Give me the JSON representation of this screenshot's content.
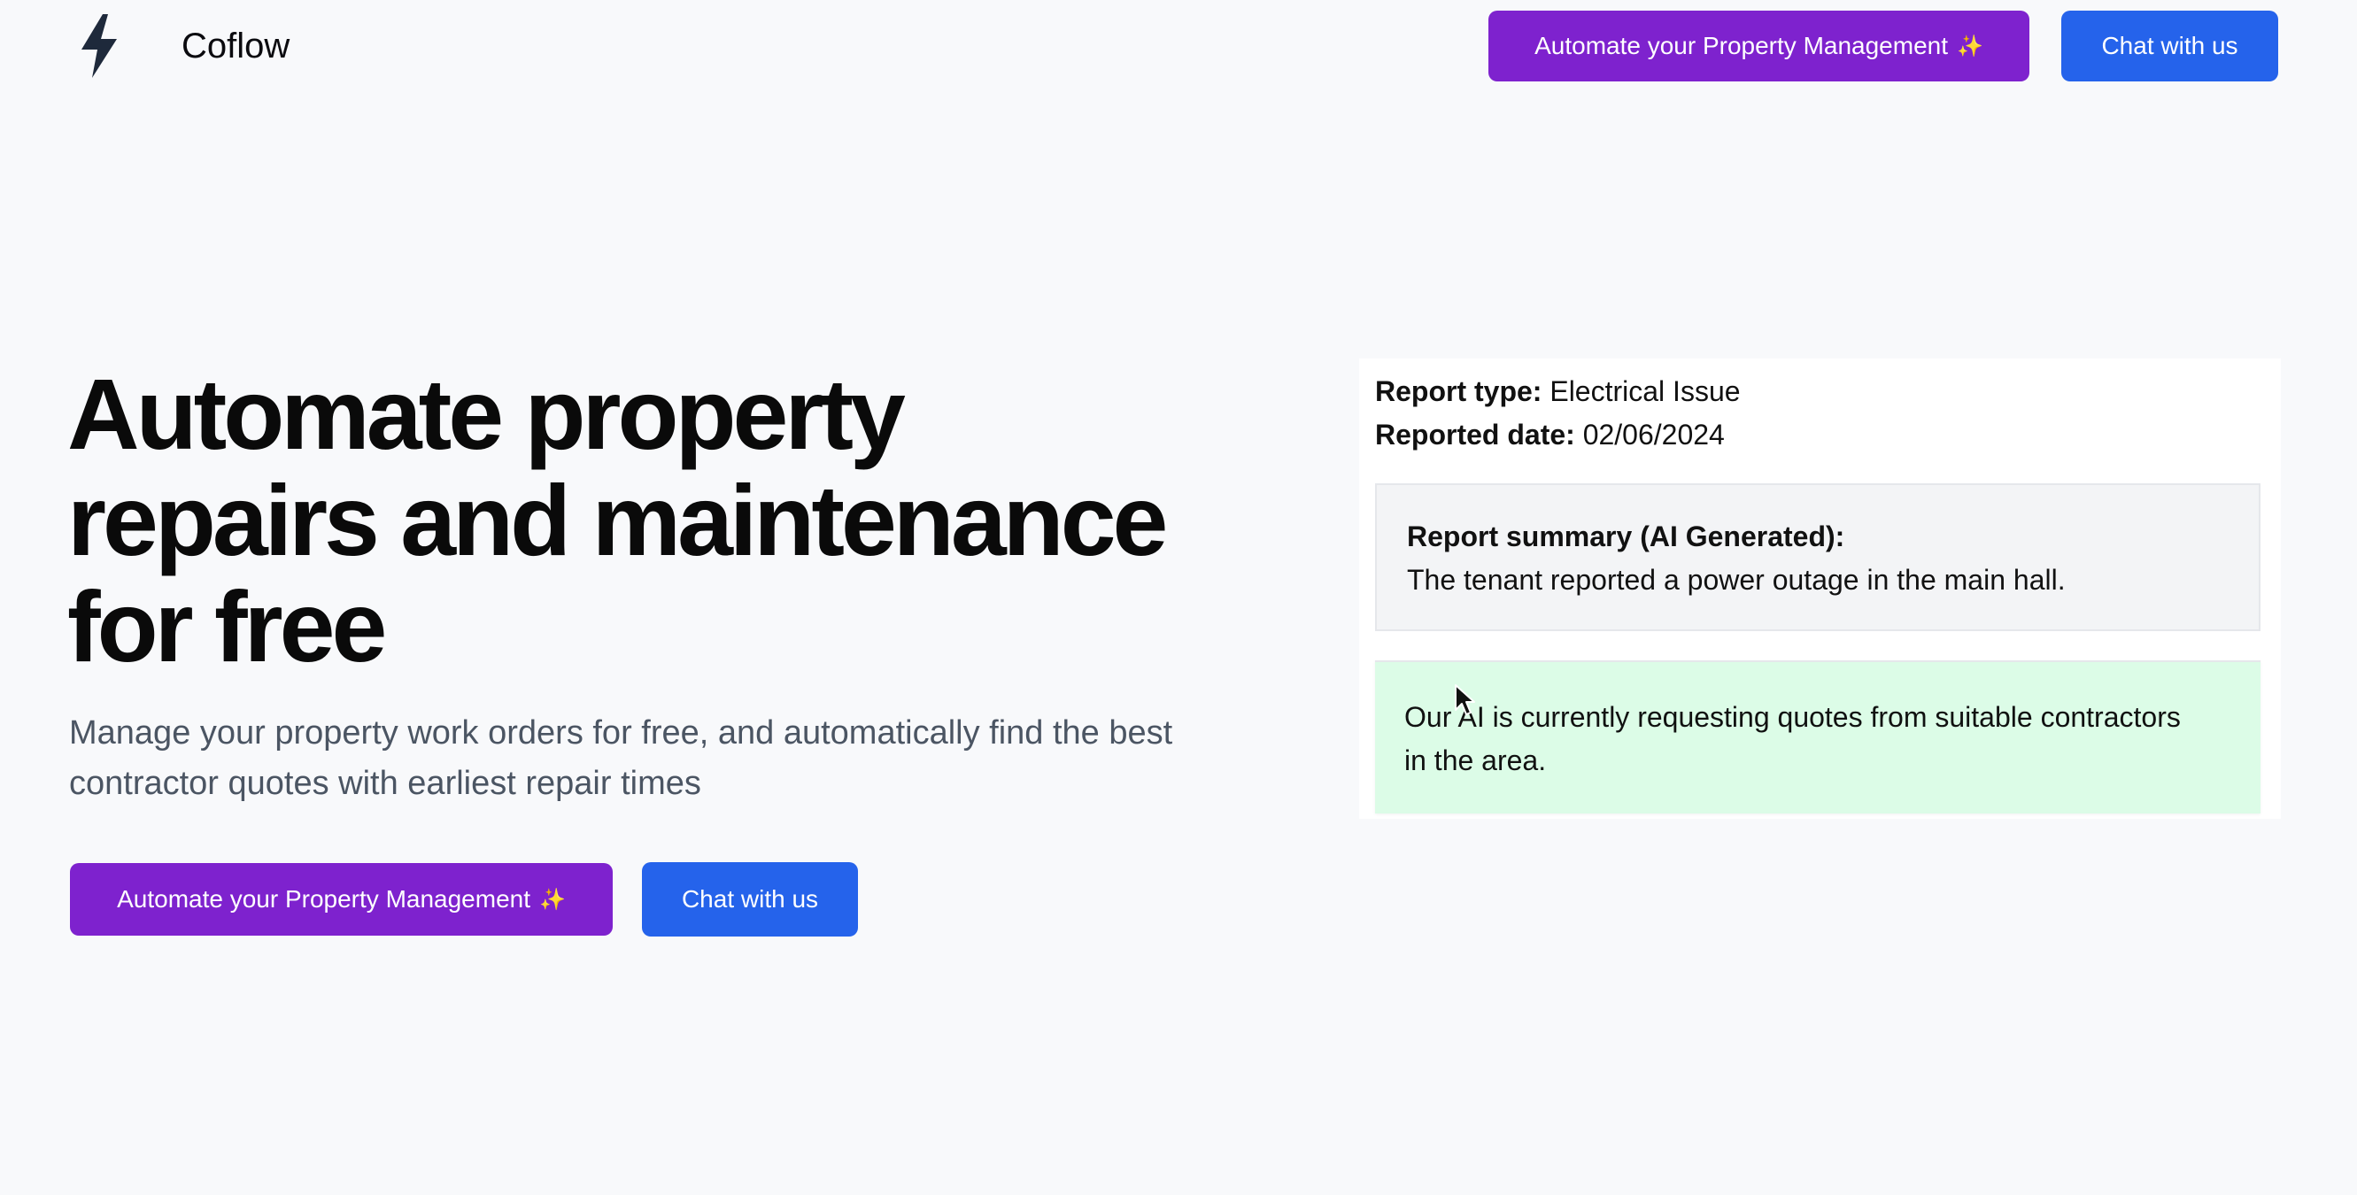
{
  "header": {
    "brand": "Coflow",
    "logo_icon": "lightning-bolt-icon",
    "cta_label": "Automate your Property Management",
    "chat_label": "Chat with us",
    "sparkle": "✨"
  },
  "hero": {
    "title_lines": [
      "Automate property",
      "repairs and maintenance",
      "for free"
    ],
    "subtitle_lines": [
      "Manage your property work orders for free, and automatically find the best",
      "contractor quotes with earliest repair times"
    ],
    "cta_label": "Automate your Property Management",
    "chat_label": "Chat with us",
    "sparkle": "✨"
  },
  "report": {
    "type_label": "Report type:",
    "type_value": "Electrical Issue",
    "date_label": "Reported date:",
    "date_value": "02/06/2024",
    "summary_title": "Report summary (AI Generated):",
    "summary_text": "The tenant reported a power outage in the main hall.",
    "ai_status_lines": [
      "Our AI is currently requesting quotes from suitable contractors",
      "in the area."
    ]
  },
  "colors": {
    "background": "#f8f9fb",
    "purple_button": "#7e22ce",
    "blue_button": "#2563eb",
    "summary_bg": "#f3f4f6",
    "ai_status_bg": "#dcfce7",
    "logo": "#1e293b"
  },
  "icons": {
    "cursor": "mouse-pointer-icon",
    "sparkle": "sparkles-icon"
  }
}
